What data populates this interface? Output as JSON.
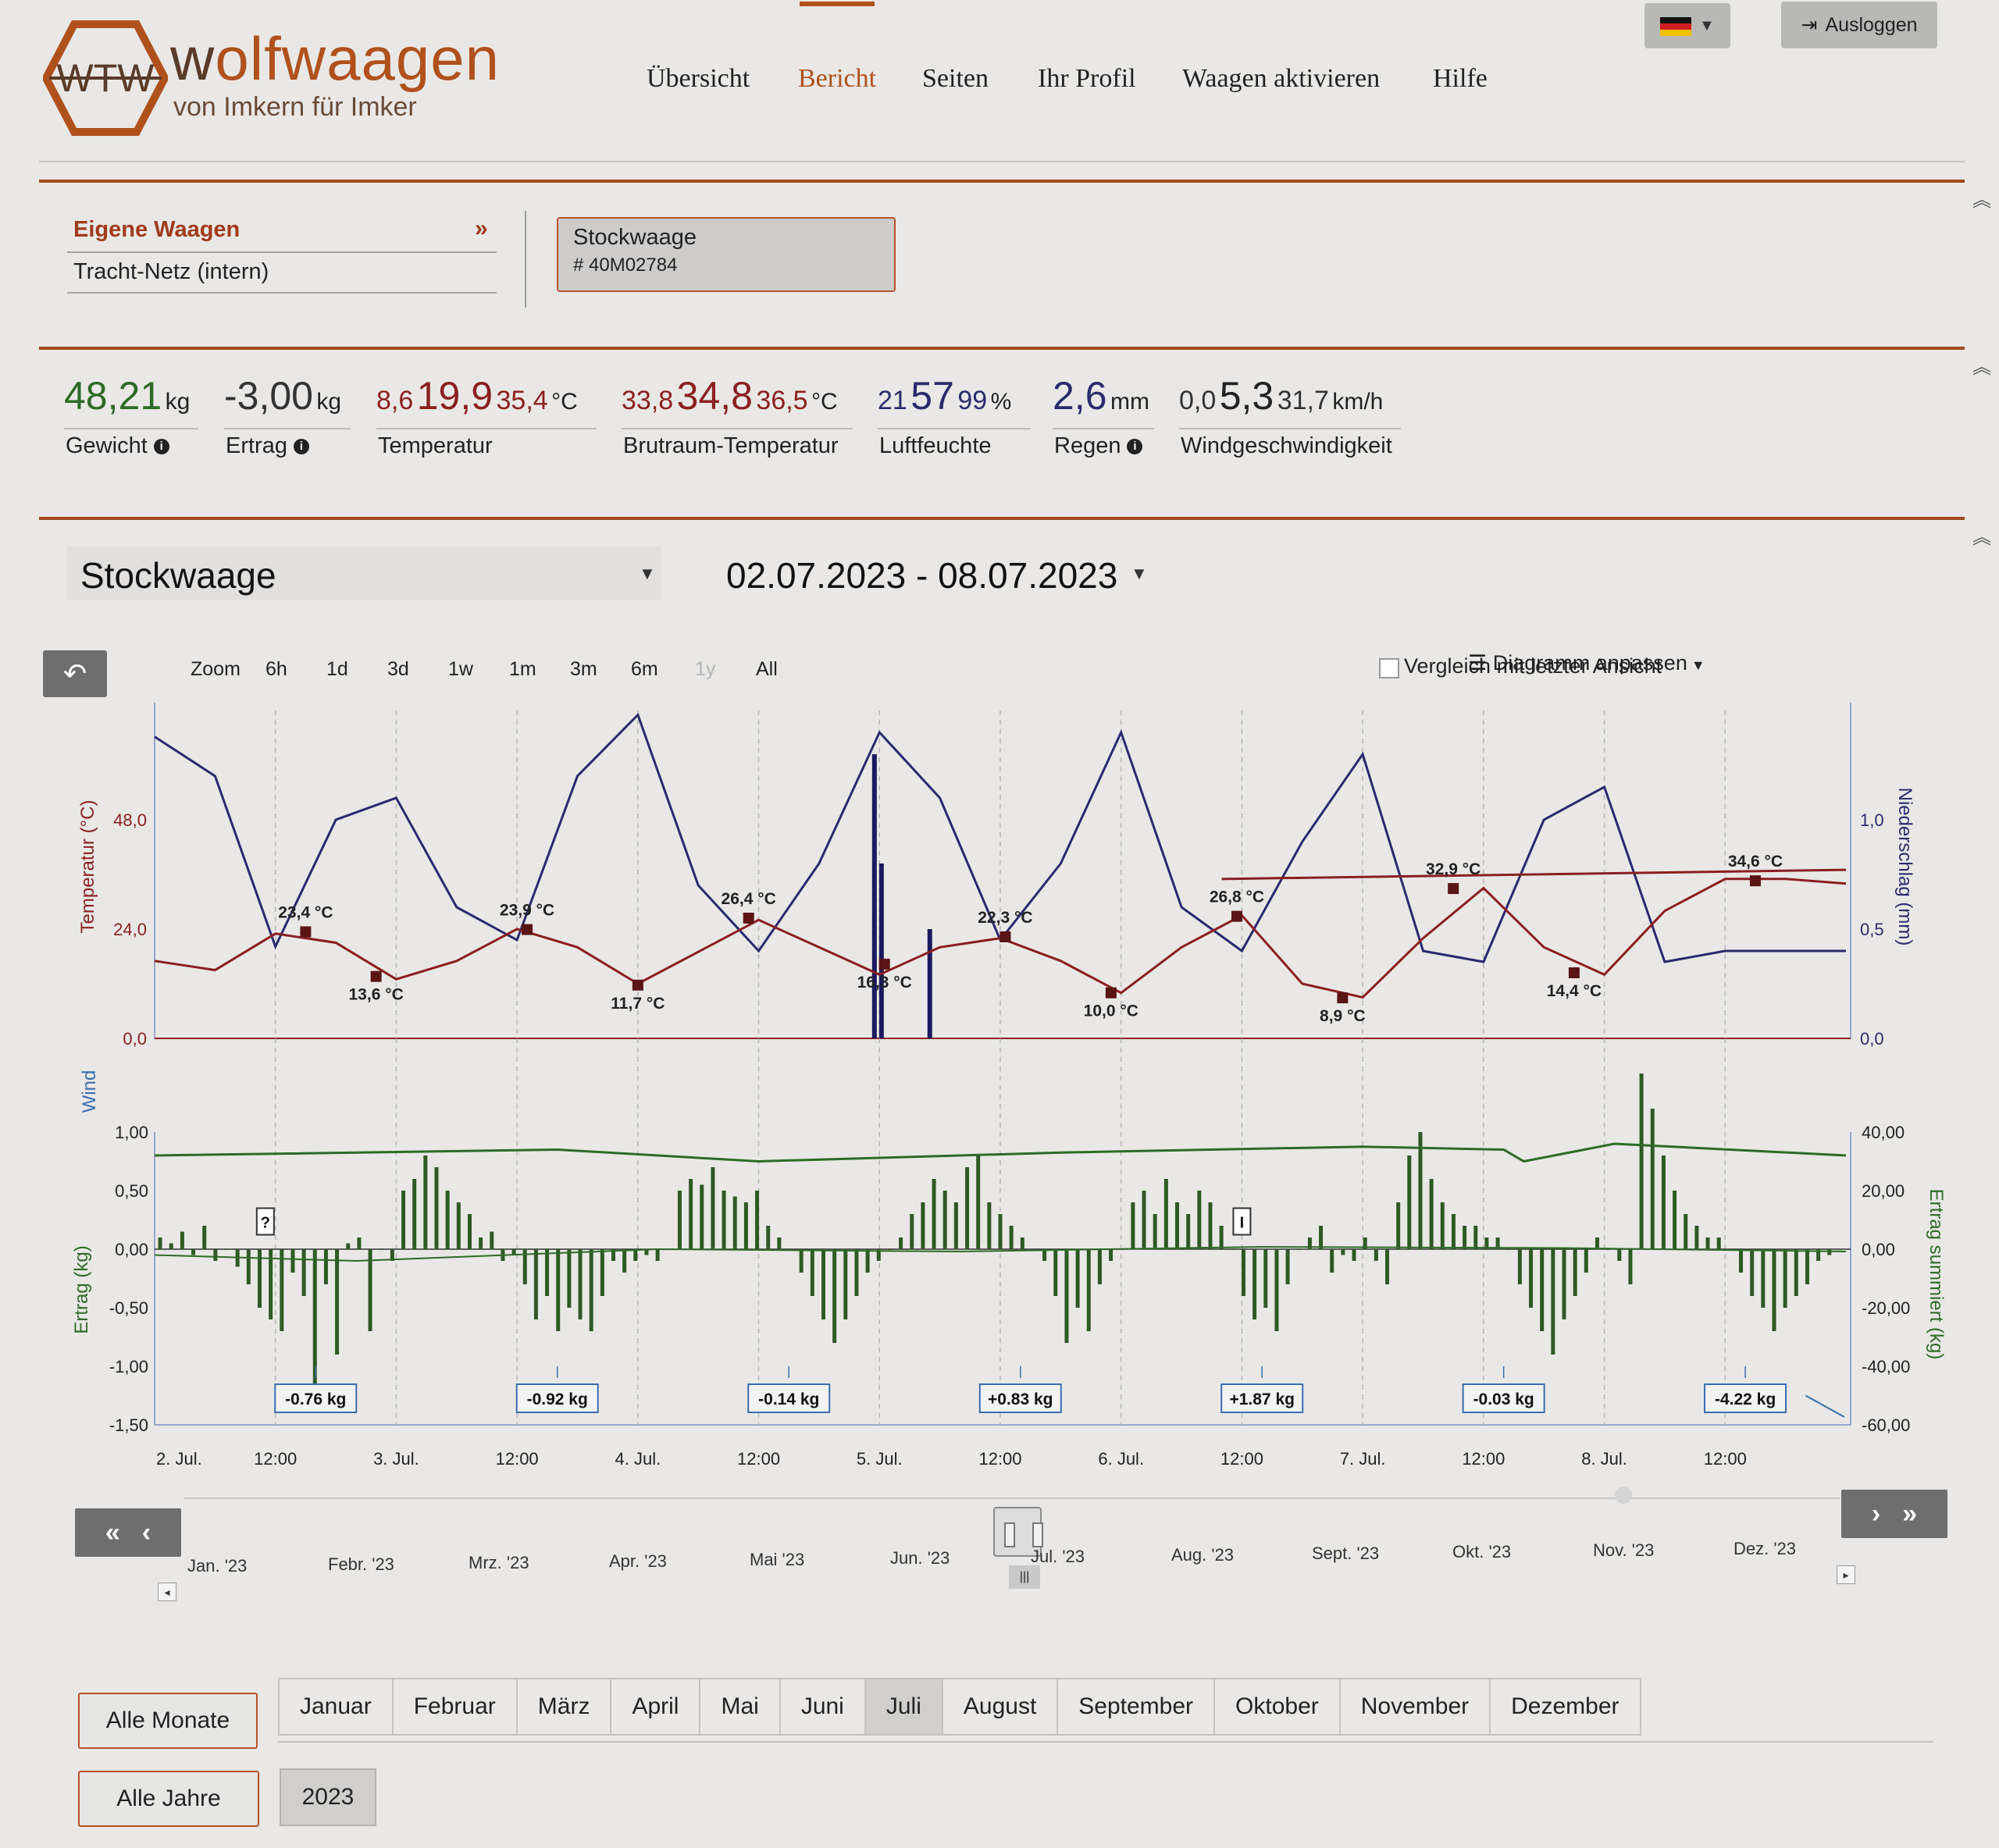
{
  "brand": {
    "name_part1": "w",
    "name_part2": "o",
    "name_part3": "lfwaagen",
    "tagline": "von Imkern für Imker",
    "logo_letters": "WTW"
  },
  "nav": [
    {
      "label": "Übersicht"
    },
    {
      "label": "Bericht",
      "active": true
    },
    {
      "label": "Seiten"
    },
    {
      "label": "Ihr Profil"
    },
    {
      "label": "Waagen aktivieren"
    },
    {
      "label": "Hilfe"
    }
  ],
  "header": {
    "logout_label": "Ausloggen",
    "language": "de"
  },
  "panel": {
    "title": "Eigene Waagen",
    "link": "Tracht-Netz (intern)",
    "scale_name": "Stockwaage",
    "scale_id": "# 40M02784"
  },
  "metrics": {
    "weight": {
      "value": "48,21",
      "unit": "kg",
      "label": "Gewicht"
    },
    "yield": {
      "value": "-3,00",
      "unit": "kg",
      "label": "Ertrag"
    },
    "temperature": {
      "min": "8,6",
      "current": "19,9",
      "max": "35,4",
      "unit": "°C",
      "label": "Temperatur"
    },
    "brood_temperature": {
      "min": "33,8",
      "current": "34,8",
      "max": "36,5",
      "unit": "°C",
      "label": "Brutraum-Temperatur"
    },
    "humidity": {
      "min": "21",
      "current": "57",
      "max": "99",
      "unit": "%",
      "label": "Luftfeuchte"
    },
    "rain": {
      "value": "2,6",
      "unit": "mm",
      "label": "Regen"
    },
    "wind": {
      "min": "0,0",
      "current": "5,3",
      "max": "31,7",
      "unit": "km/h",
      "label": "Windgeschwindigkeit"
    }
  },
  "colors": {
    "accent": "#b0511c",
    "temp": "#8b1f1f",
    "humidity": "#2a2a6e",
    "green": "#2e6b26",
    "wind_label": "#3a6db0"
  },
  "selectors": {
    "scale": "Stockwaage",
    "date_range": "02.07.2023 - 08.07.2023"
  },
  "toolbar": {
    "zoom_label": "Zoom",
    "zoom_options": [
      "6h",
      "1d",
      "3d",
      "1w",
      "1m",
      "3m",
      "6m",
      "1y",
      "All"
    ],
    "compare_label": "Vergleich mit letzter Ansicht",
    "adjust_label": "Diagramm anpassen"
  },
  "chart_data": [
    {
      "type": "line",
      "title": "",
      "x_ticks": [
        "2. Jul.",
        "12:00",
        "3. Jul.",
        "12:00",
        "4. Jul.",
        "12:00",
        "5. Jul.",
        "12:00",
        "6. Jul.",
        "12:00",
        "7. Jul.",
        "12:00",
        "8. Jul.",
        "12:00"
      ],
      "ylabel_left": "Temperatur (°C)",
      "y_ticks_left": [
        "0,0",
        "24,0",
        "48,0"
      ],
      "ylim_left": [
        0,
        72
      ],
      "ylabel_right": "Niederschlag (mm)",
      "y_ticks_right": [
        "0,0",
        "0,5",
        "1,0"
      ],
      "ylim_right": [
        0,
        1.5
      ],
      "series": [
        {
          "values_hours": [
            0,
            6,
            12,
            18,
            24,
            30,
            36,
            42,
            48,
            54,
            60,
            66,
            72,
            78,
            84,
            90,
            96,
            102,
            108,
            114,
            120,
            126,
            132,
            138,
            144,
            150,
            156,
            162,
            168
          ],
          "values": [
            17,
            15,
            23,
            21,
            13,
            17,
            24,
            20,
            12,
            19,
            26,
            20,
            14,
            20,
            22,
            17,
            10,
            20,
            27,
            12,
            9,
            22,
            33,
            20,
            14,
            28,
            35,
            35,
            34
          ]
        },
        {
          "values_hours": [
            0,
            6,
            12,
            18,
            24,
            30,
            36,
            42,
            48,
            54,
            60,
            66,
            72,
            78,
            84,
            90,
            96,
            102,
            108,
            114,
            120,
            126,
            132,
            138,
            144,
            150,
            156,
            162,
            168
          ],
          "values": [
            1.38,
            1.2,
            0.42,
            1.0,
            1.1,
            0.6,
            0.45,
            1.2,
            1.48,
            0.7,
            0.4,
            0.8,
            1.4,
            1.1,
            0.45,
            0.8,
            1.4,
            0.6,
            0.4,
            0.9,
            1.3,
            0.4,
            0.35,
            1.0,
            1.15,
            0.35,
            0.4,
            0.4,
            0.4
          ]
        }
      ],
      "precip_bars": [
        {
          "hour": 71.5,
          "value": 1.3
        },
        {
          "hour": 72.2,
          "value": 0.8
        },
        {
          "hour": 77,
          "value": 0.5
        }
      ],
      "annotations": [
        {
          "hour": 15,
          "value": 23.4,
          "label": "23,4 °C"
        },
        {
          "hour": 22,
          "value": 13.6,
          "label": "13,6 °C"
        },
        {
          "hour": 37,
          "value": 23.9,
          "label": "23,9 °C"
        },
        {
          "hour": 48,
          "value": 11.7,
          "label": "11,7 °C"
        },
        {
          "hour": 59,
          "value": 26.4,
          "label": "26,4 °C"
        },
        {
          "hour": 72.5,
          "value": 16.3,
          "label": "16,3 °C"
        },
        {
          "hour": 84.5,
          "value": 22.3,
          "label": "22,3 °C"
        },
        {
          "hour": 95,
          "value": 10.0,
          "label": "10,0 °C"
        },
        {
          "hour": 107.5,
          "value": 26.8,
          "label": "26,8 °C"
        },
        {
          "hour": 118,
          "value": 8.9,
          "label": "8,9 °C"
        },
        {
          "hour": 129,
          "value": 32.9,
          "label": "32,9 °C"
        },
        {
          "hour": 141,
          "value": 14.4,
          "label": "14,4 °C"
        },
        {
          "hour": 159,
          "value": 34.6,
          "label": "34,6 °C"
        }
      ]
    },
    {
      "type": "bar",
      "title": "",
      "label_wind": "Wind",
      "ylabel_left": "Ertrag (kg)",
      "y_ticks_left": [
        "-1,50",
        "-1,00",
        "-0,50",
        "0,00",
        "0,50",
        "1,00"
      ],
      "ylim_left": [
        -1.5,
        1.0
      ],
      "ylabel_right": "Ertrag summiert (kg)",
      "y_ticks_right": [
        "-60,00",
        "-40,00",
        "-20,00",
        "0,00",
        "20,00",
        "40,00"
      ],
      "ylim_right": [
        -60,
        40
      ],
      "daily_labels": [
        {
          "hour": 16,
          "label": "-0.76 kg"
        },
        {
          "hour": 40,
          "label": "-0.92 kg"
        },
        {
          "hour": 63,
          "label": "-0.14 kg"
        },
        {
          "hour": 86,
          "label": "+0.83 kg"
        },
        {
          "hour": 110,
          "label": "+1.87 kg"
        },
        {
          "hour": 134,
          "label": "-0.03 kg"
        },
        {
          "hour": 158,
          "label": "-4.22 kg"
        }
      ],
      "markers": [
        {
          "hour": 11,
          "label": "?"
        },
        {
          "hour": 108,
          "label": "I"
        }
      ],
      "hourly_yield": [
        0.1,
        0.05,
        0.15,
        -0.05,
        0.2,
        -0.1,
        0,
        -0.15,
        -0.3,
        -0.5,
        -0.6,
        -0.7,
        -0.2,
        -0.4,
        -1.2,
        -0.3,
        -0.9,
        0.05,
        0.1,
        -0.7,
        0,
        -0.1,
        0.5,
        0.6,
        0.8,
        0.7,
        0.5,
        0.4,
        0.3,
        0.1,
        0.15,
        -0.1,
        -0.05,
        -0.3,
        -0.6,
        -0.4,
        -0.7,
        -0.5,
        -0.6,
        -0.7,
        -0.4,
        -0.1,
        -0.2,
        -0.1,
        -0.05,
        -0.1,
        0,
        0.5,
        0.6,
        0.55,
        0.7,
        0.5,
        0.45,
        0.4,
        0.5,
        0.2,
        0.1,
        0,
        -0.2,
        -0.4,
        -0.6,
        -0.8,
        -0.6,
        -0.4,
        -0.2,
        -0.1,
        0,
        0.1,
        0.3,
        0.4,
        0.6,
        0.5,
        0.4,
        0.7,
        0.8,
        0.4,
        0.3,
        0.2,
        0.1,
        0,
        -0.1,
        -0.4,
        -0.8,
        -0.5,
        -0.7,
        -0.3,
        -0.1,
        0,
        0.4,
        0.5,
        0.3,
        0.6,
        0.4,
        0.3,
        0.5,
        0.4,
        0.2,
        0,
        -0.4,
        -0.6,
        -0.5,
        -0.7,
        -0.3,
        0,
        0.1,
        0.2,
        -0.2,
        -0.05,
        -0.1,
        0.1,
        -0.1,
        -0.3,
        0.4,
        0.8,
        1.0,
        0.6,
        0.4,
        0.3,
        0.2,
        0.2,
        0.1,
        0.1,
        0,
        -0.3,
        -0.5,
        -0.7,
        -0.9,
        -0.6,
        -0.4,
        -0.2,
        0.1,
        0,
        -0.1,
        -0.3,
        1.5,
        1.2,
        0.8,
        0.5,
        0.3,
        0.2,
        0.1,
        0.1,
        0,
        -0.2,
        -0.4,
        -0.5,
        -0.7,
        -0.5,
        -0.4,
        -0.3,
        -0.1,
        -0.05,
        0
      ]
    }
  ],
  "navigator": {
    "months": [
      "Jan. '23",
      "Febr. '23",
      "Mrz. '23",
      "Apr. '23",
      "Mai '23",
      "Jun. '23",
      "Jul. '23",
      "Aug. '23",
      "Sept. '23",
      "Okt. '23",
      "Nov. '23",
      "Dez. '23"
    ]
  },
  "filters": {
    "all_months": "Alle Monate",
    "months": [
      "Januar",
      "Februar",
      "März",
      "April",
      "Mai",
      "Juni",
      "Juli",
      "August",
      "September",
      "Oktober",
      "November",
      "Dezember"
    ],
    "active_month": "Juli",
    "all_years": "Alle Jahre",
    "year": "2023"
  }
}
